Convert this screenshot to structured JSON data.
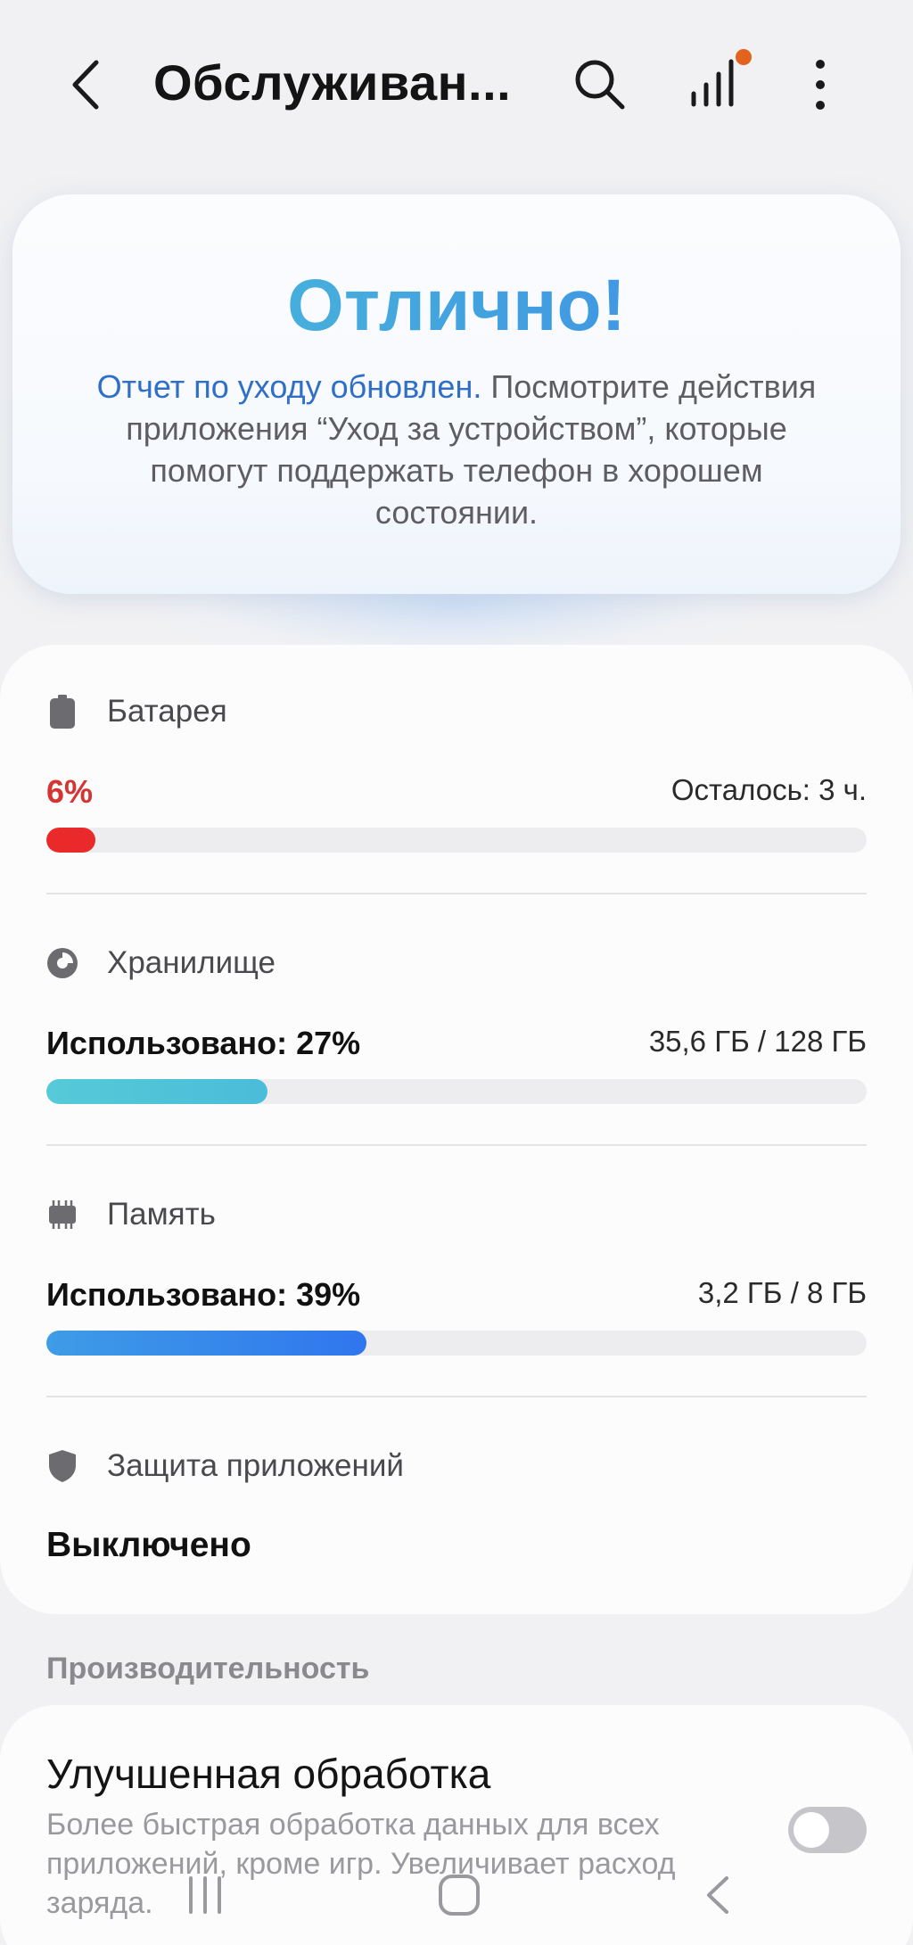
{
  "header": {
    "title": "Обслуживан...",
    "icons": [
      "back-icon",
      "search-icon",
      "signal-icon",
      "more-icon"
    ],
    "notification_dot_color": "#e3621d"
  },
  "status": {
    "title": "Отлично!",
    "link_text": "Отчет по уходу обновлен.",
    "body_text": " Посмотрите действия приложения “Уход за устройством”, которые помогут поддержать телефон в хорошем состоянии."
  },
  "battery": {
    "label": "Батарея",
    "percent_text": "6%",
    "remaining": "Осталось: 3 ч.",
    "level": 0.06,
    "color": "#ea2a2a"
  },
  "storage": {
    "label": "Хранилище",
    "used_text": "Использовано: 27%",
    "amount": "35,6 ГБ / 128 ГБ",
    "level": 0.27,
    "color": "#56cad8"
  },
  "memory": {
    "label": "Память",
    "used_text": "Использовано: 39%",
    "amount": "3,2 ГБ / 8 ГБ",
    "level": 0.39,
    "color": "#2f76ef"
  },
  "app_protection": {
    "label": "Защита приложений",
    "status": "Выключено"
  },
  "performance": {
    "section_label": "Производительность",
    "item_title": "Улучшенная обработка",
    "item_desc": "Более быстрая обработка данных для всех приложений, кроме игр. Увеличивает расход заряда.",
    "toggle_on": false
  },
  "navbar": {
    "icons": [
      "recent-apps-icon",
      "home-icon",
      "nav-back-icon"
    ]
  }
}
